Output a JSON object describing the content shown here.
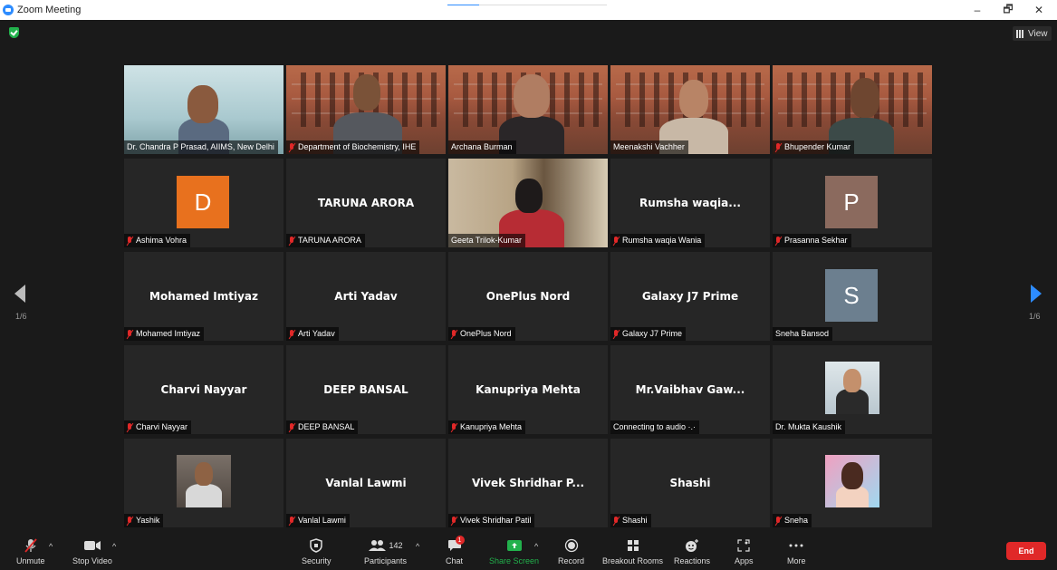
{
  "window": {
    "title": "Zoom Meeting",
    "minimize": "–",
    "maximize": "🗗",
    "close": "✕",
    "progress_fraction": 0.2
  },
  "meeting": {
    "view_label": "View",
    "page_indicator": "1/6"
  },
  "tiles": [
    {
      "label": "Dr. Chandra P Prasad, AIIMS, New Delhi",
      "muted": false,
      "type": "video"
    },
    {
      "label": "Department of Biochemistry, IHE",
      "muted": true,
      "type": "video"
    },
    {
      "label": "Archana Burman",
      "muted": false,
      "type": "video"
    },
    {
      "label": "Meenakshi Vachher",
      "muted": false,
      "type": "video"
    },
    {
      "label": "Bhupender Kumar",
      "muted": true,
      "type": "video"
    },
    {
      "label": "Ashima Vohra",
      "muted": true,
      "type": "avatar",
      "initial": "D",
      "color": "#e8711e"
    },
    {
      "label": "TARUNA ARORA",
      "muted": true,
      "type": "name",
      "display": "TARUNA ARORA"
    },
    {
      "label": "Geeta Trilok-Kumar",
      "muted": false,
      "type": "video",
      "active": true
    },
    {
      "label": "Rumsha waqia Wania",
      "muted": true,
      "type": "name",
      "display": "Rumsha waqia..."
    },
    {
      "label": "Prasanna Sekhar",
      "muted": true,
      "type": "avatar",
      "initial": "P",
      "color": "#8b6a5e"
    },
    {
      "label": "Mohamed Imtiyaz",
      "muted": true,
      "type": "name",
      "display": "Mohamed Imtiyaz"
    },
    {
      "label": "Arti Yadav",
      "muted": true,
      "type": "name",
      "display": "Arti Yadav"
    },
    {
      "label": "OnePlus Nord",
      "muted": true,
      "type": "name",
      "display": "OnePlus Nord"
    },
    {
      "label": "Galaxy J7 Prime",
      "muted": true,
      "type": "name",
      "display": "Galaxy J7 Prime"
    },
    {
      "label": "Sneha Bansod",
      "muted": false,
      "type": "avatar",
      "initial": "S",
      "color": "#6c7f8f"
    },
    {
      "label": "Charvi Nayyar",
      "muted": true,
      "type": "name",
      "display": "Charvi Nayyar"
    },
    {
      "label": "DEEP BANSAL",
      "muted": true,
      "type": "name",
      "display": "DEEP BANSAL"
    },
    {
      "label": "Kanupriya Mehta",
      "muted": true,
      "type": "name",
      "display": "Kanupriya Mehta"
    },
    {
      "label": "Connecting to audio ·.·",
      "muted": false,
      "type": "name",
      "display": "Mr.Vaibhav Gaw..."
    },
    {
      "label": "Dr. Mukta Kaushik",
      "muted": false,
      "type": "photo"
    },
    {
      "label": "Yashik",
      "muted": true,
      "type": "photo"
    },
    {
      "label": "Vanlal Lawmi",
      "muted": true,
      "type": "name",
      "display": "Vanlal Lawmi"
    },
    {
      "label": "Vivek Shridhar Patil",
      "muted": true,
      "type": "name",
      "display": "Vivek Shridhar P..."
    },
    {
      "label": "Shashi",
      "muted": true,
      "type": "name",
      "display": "Shashi"
    },
    {
      "label": "Sneha",
      "muted": true,
      "type": "photo"
    }
  ],
  "toolbar": {
    "unmute": "Unmute",
    "stop_video": "Stop Video",
    "security": "Security",
    "participants": "Participants",
    "participants_count": "142",
    "chat": "Chat",
    "chat_badge": "1",
    "share_screen": "Share Screen",
    "record": "Record",
    "breakout_rooms": "Breakout Rooms",
    "reactions": "Reactions",
    "apps": "Apps",
    "more": "More",
    "end": "End"
  },
  "colors": {
    "accent": "#2d8cff",
    "end": "#e02828",
    "share": "#22b14c",
    "active_outline": "#c9e36a"
  }
}
